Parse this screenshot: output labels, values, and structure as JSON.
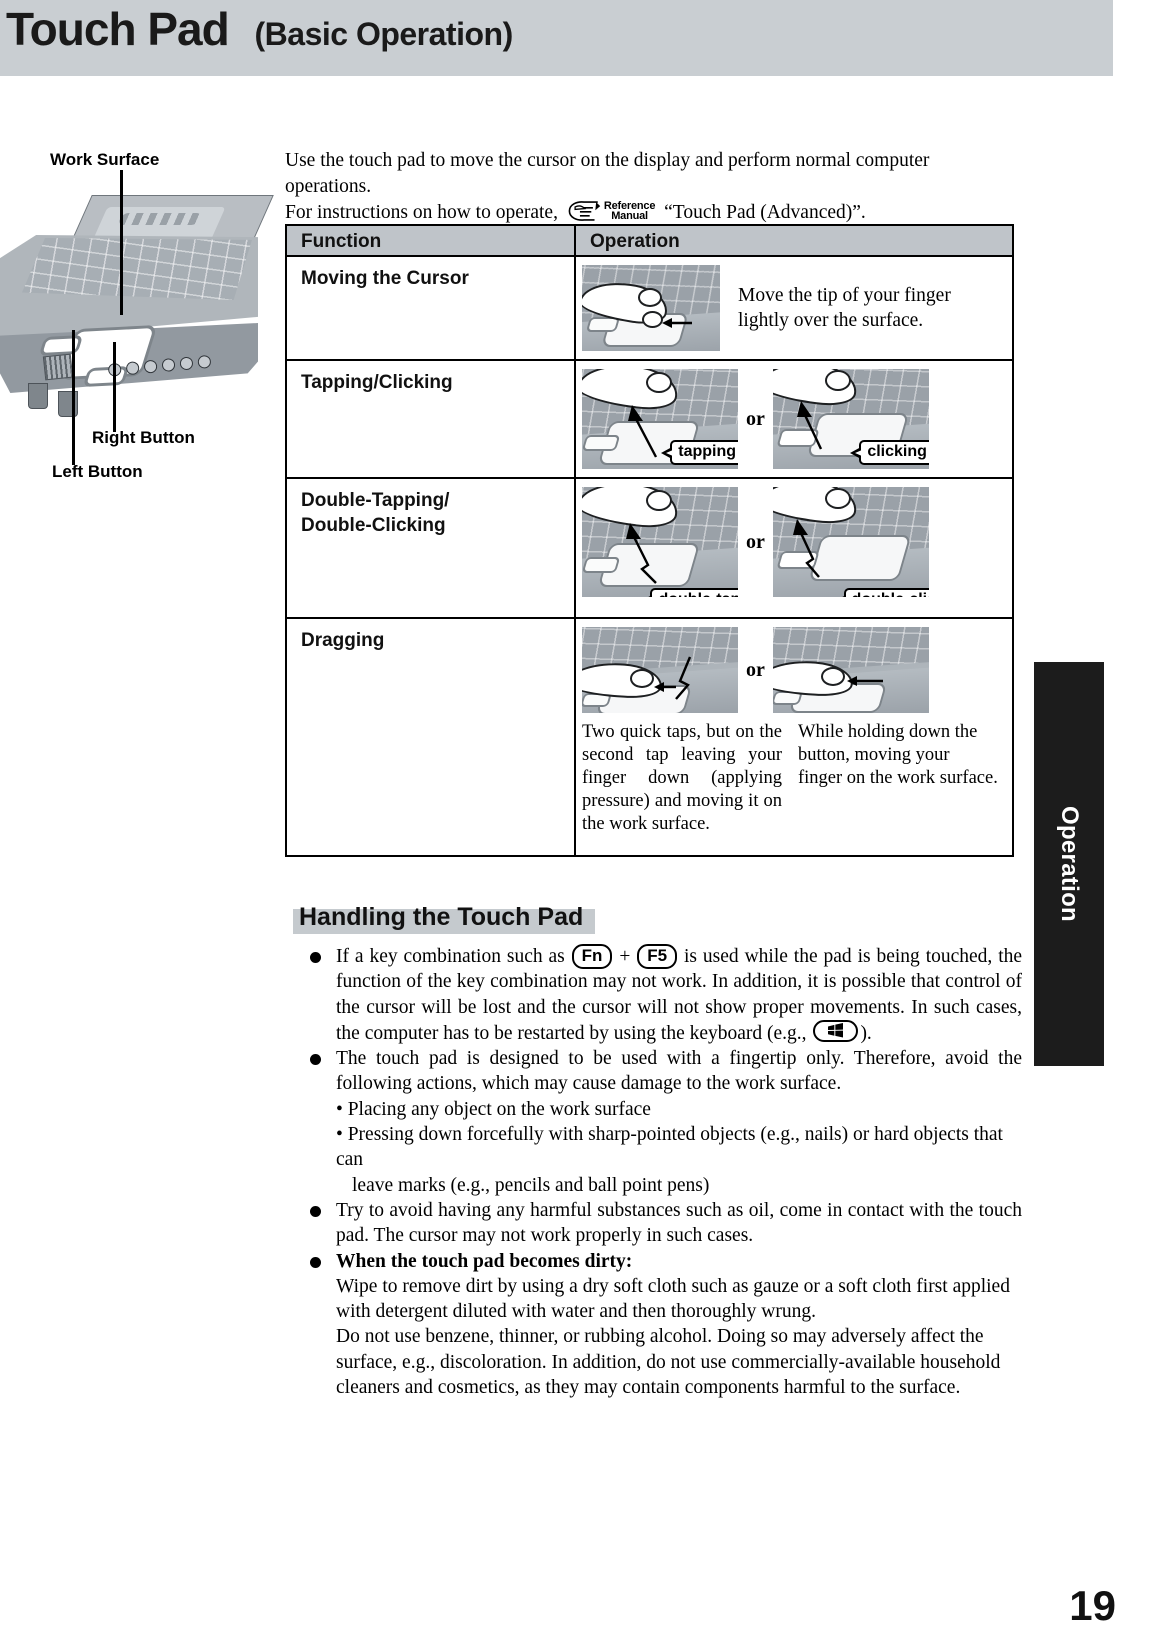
{
  "header": {
    "title_main": "Touch Pad",
    "title_sub": "(Basic Operation)"
  },
  "illustration": {
    "label_work_surface": "Work Surface",
    "label_right_button": "Right Button",
    "label_left_button": "Left Button"
  },
  "intro": {
    "line1": "Use the touch pad to move the cursor on the display and perform normal computer operations.",
    "line2_before": "For instructions on how to operate,",
    "reference_icon_line1": "Reference",
    "reference_icon_line2": "Manual",
    "line2_after": "“Touch Pad (Advanced)”."
  },
  "table": {
    "headers": {
      "function": "Function",
      "operation": "Operation"
    },
    "rows": [
      {
        "function": "Moving the Cursor",
        "description": "Move the tip of your finger lightly over the surface."
      },
      {
        "function": "Tapping/Clicking",
        "or": "or",
        "callout_left": "tapping",
        "callout_right": "clicking"
      },
      {
        "function": "Double-Tapping/\nDouble-Clicking",
        "or": "or",
        "callout_left": "double-tapping",
        "callout_right": "double-clicking"
      },
      {
        "function": "Dragging",
        "or": "or",
        "desc_left": "Two quick taps, but on the second tap leaving your finger down (applying pressure) and moving it on the work surface.",
        "desc_right": "While holding down the button, moving your finger on the work surface."
      }
    ]
  },
  "section": {
    "heading": "Handling the Touch Pad",
    "bullets": [
      {
        "part1": "If a key combination such as",
        "key1": "Fn",
        "plus": "+",
        "key2": "F5",
        "part2": "is used while the pad is being touched, the function of the key combination may not work.  In addition, it is possible that control of the cursor will be lost and the cursor will not show proper movements.  In such cases, the computer has to be restarted by using the keyboard (e.g.,",
        "win_key_icon": "windows-key-icon",
        "part3": ")."
      },
      {
        "text": "The touch pad is designed to be used with a fingertip only. Therefore, avoid the following actions, which may cause damage to the work surface.",
        "sub_items": [
          "• Placing any object on the work surface",
          "• Pressing down forcefully with sharp-pointed objects (e.g., nails) or hard objects that can",
          "leave marks (e.g., pencils and ball point pens)"
        ]
      },
      {
        "text": "Try to avoid having any harmful substances such as oil, come in contact with the touch pad. The cursor may not work properly in such cases."
      },
      {
        "bold_lead": "When the touch pad becomes dirty:",
        "text": "Wipe to remove dirt by using a dry soft cloth such as gauze or a soft cloth first applied with detergent diluted with water and then thoroughly wrung.",
        "text2": "Do not use benzene, thinner, or rubbing alcohol.  Doing so may adversely affect the surface, e.g., discoloration. In addition, do not use commercially-available household cleaners and cosmetics, as they may contain components harmful to the surface."
      }
    ]
  },
  "side_tab": {
    "label": "Operation"
  },
  "page_number": "19",
  "colors": {
    "header_band": "#c9ced2",
    "table_header": "#bfc4c9",
    "section_highlight": "#c5cace",
    "side_tab": "#1c1c1c"
  }
}
